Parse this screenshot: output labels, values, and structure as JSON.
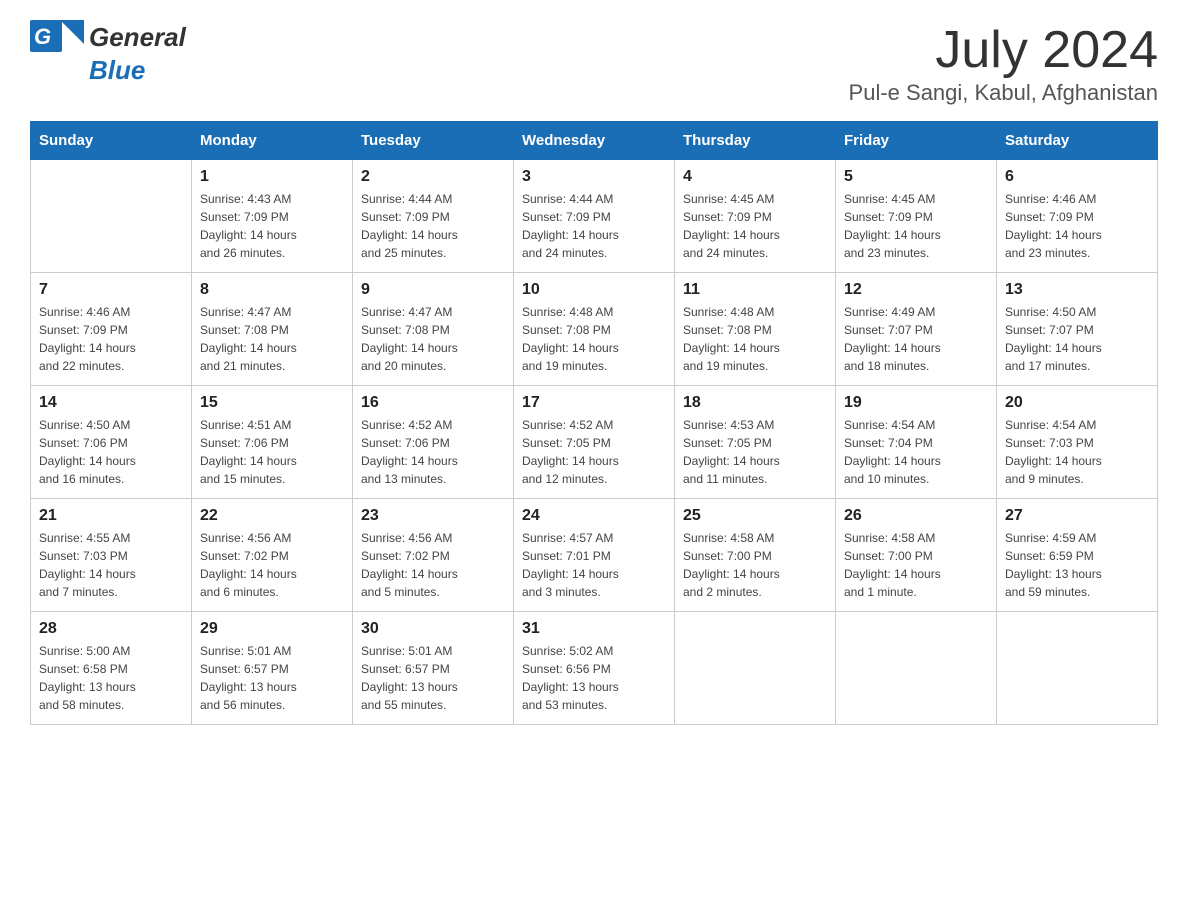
{
  "header": {
    "logo_general": "General",
    "logo_blue": "Blue",
    "title": "July 2024",
    "subtitle": "Pul-e Sangi, Kabul, Afghanistan"
  },
  "calendar": {
    "columns": [
      "Sunday",
      "Monday",
      "Tuesday",
      "Wednesday",
      "Thursday",
      "Friday",
      "Saturday"
    ],
    "weeks": [
      [
        {
          "day": "",
          "info": ""
        },
        {
          "day": "1",
          "info": "Sunrise: 4:43 AM\nSunset: 7:09 PM\nDaylight: 14 hours\nand 26 minutes."
        },
        {
          "day": "2",
          "info": "Sunrise: 4:44 AM\nSunset: 7:09 PM\nDaylight: 14 hours\nand 25 minutes."
        },
        {
          "day": "3",
          "info": "Sunrise: 4:44 AM\nSunset: 7:09 PM\nDaylight: 14 hours\nand 24 minutes."
        },
        {
          "day": "4",
          "info": "Sunrise: 4:45 AM\nSunset: 7:09 PM\nDaylight: 14 hours\nand 24 minutes."
        },
        {
          "day": "5",
          "info": "Sunrise: 4:45 AM\nSunset: 7:09 PM\nDaylight: 14 hours\nand 23 minutes."
        },
        {
          "day": "6",
          "info": "Sunrise: 4:46 AM\nSunset: 7:09 PM\nDaylight: 14 hours\nand 23 minutes."
        }
      ],
      [
        {
          "day": "7",
          "info": "Sunrise: 4:46 AM\nSunset: 7:09 PM\nDaylight: 14 hours\nand 22 minutes."
        },
        {
          "day": "8",
          "info": "Sunrise: 4:47 AM\nSunset: 7:08 PM\nDaylight: 14 hours\nand 21 minutes."
        },
        {
          "day": "9",
          "info": "Sunrise: 4:47 AM\nSunset: 7:08 PM\nDaylight: 14 hours\nand 20 minutes."
        },
        {
          "day": "10",
          "info": "Sunrise: 4:48 AM\nSunset: 7:08 PM\nDaylight: 14 hours\nand 19 minutes."
        },
        {
          "day": "11",
          "info": "Sunrise: 4:48 AM\nSunset: 7:08 PM\nDaylight: 14 hours\nand 19 minutes."
        },
        {
          "day": "12",
          "info": "Sunrise: 4:49 AM\nSunset: 7:07 PM\nDaylight: 14 hours\nand 18 minutes."
        },
        {
          "day": "13",
          "info": "Sunrise: 4:50 AM\nSunset: 7:07 PM\nDaylight: 14 hours\nand 17 minutes."
        }
      ],
      [
        {
          "day": "14",
          "info": "Sunrise: 4:50 AM\nSunset: 7:06 PM\nDaylight: 14 hours\nand 16 minutes."
        },
        {
          "day": "15",
          "info": "Sunrise: 4:51 AM\nSunset: 7:06 PM\nDaylight: 14 hours\nand 15 minutes."
        },
        {
          "day": "16",
          "info": "Sunrise: 4:52 AM\nSunset: 7:06 PM\nDaylight: 14 hours\nand 13 minutes."
        },
        {
          "day": "17",
          "info": "Sunrise: 4:52 AM\nSunset: 7:05 PM\nDaylight: 14 hours\nand 12 minutes."
        },
        {
          "day": "18",
          "info": "Sunrise: 4:53 AM\nSunset: 7:05 PM\nDaylight: 14 hours\nand 11 minutes."
        },
        {
          "day": "19",
          "info": "Sunrise: 4:54 AM\nSunset: 7:04 PM\nDaylight: 14 hours\nand 10 minutes."
        },
        {
          "day": "20",
          "info": "Sunrise: 4:54 AM\nSunset: 7:03 PM\nDaylight: 14 hours\nand 9 minutes."
        }
      ],
      [
        {
          "day": "21",
          "info": "Sunrise: 4:55 AM\nSunset: 7:03 PM\nDaylight: 14 hours\nand 7 minutes."
        },
        {
          "day": "22",
          "info": "Sunrise: 4:56 AM\nSunset: 7:02 PM\nDaylight: 14 hours\nand 6 minutes."
        },
        {
          "day": "23",
          "info": "Sunrise: 4:56 AM\nSunset: 7:02 PM\nDaylight: 14 hours\nand 5 minutes."
        },
        {
          "day": "24",
          "info": "Sunrise: 4:57 AM\nSunset: 7:01 PM\nDaylight: 14 hours\nand 3 minutes."
        },
        {
          "day": "25",
          "info": "Sunrise: 4:58 AM\nSunset: 7:00 PM\nDaylight: 14 hours\nand 2 minutes."
        },
        {
          "day": "26",
          "info": "Sunrise: 4:58 AM\nSunset: 7:00 PM\nDaylight: 14 hours\nand 1 minute."
        },
        {
          "day": "27",
          "info": "Sunrise: 4:59 AM\nSunset: 6:59 PM\nDaylight: 13 hours\nand 59 minutes."
        }
      ],
      [
        {
          "day": "28",
          "info": "Sunrise: 5:00 AM\nSunset: 6:58 PM\nDaylight: 13 hours\nand 58 minutes."
        },
        {
          "day": "29",
          "info": "Sunrise: 5:01 AM\nSunset: 6:57 PM\nDaylight: 13 hours\nand 56 minutes."
        },
        {
          "day": "30",
          "info": "Sunrise: 5:01 AM\nSunset: 6:57 PM\nDaylight: 13 hours\nand 55 minutes."
        },
        {
          "day": "31",
          "info": "Sunrise: 5:02 AM\nSunset: 6:56 PM\nDaylight: 13 hours\nand 53 minutes."
        },
        {
          "day": "",
          "info": ""
        },
        {
          "day": "",
          "info": ""
        },
        {
          "day": "",
          "info": ""
        }
      ]
    ]
  }
}
